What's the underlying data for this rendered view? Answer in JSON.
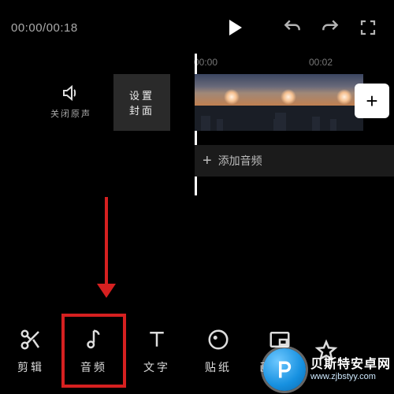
{
  "topbar": {
    "current_time": "00:00",
    "total_time": "00:18",
    "time_display": "00:00/00:18"
  },
  "ruler": {
    "t0": "00:00",
    "t1": "00:02"
  },
  "mute": {
    "label": "关闭原声"
  },
  "cover": {
    "line1": "设置",
    "line2": "封面"
  },
  "add_clip_glyph": "+",
  "audio_track": {
    "plus_glyph": "+",
    "label": "添加音频"
  },
  "toolbar": {
    "items": [
      {
        "id": "cut",
        "label": "剪辑"
      },
      {
        "id": "audio",
        "label": "音频"
      },
      {
        "id": "text",
        "label": "文字"
      },
      {
        "id": "sticker",
        "label": "贴纸"
      },
      {
        "id": "pip",
        "label": "画中画"
      },
      {
        "id": "fx",
        "label": "特效"
      }
    ]
  },
  "watermark": {
    "title": "贝斯特安卓网",
    "url": "www.zjbstyy.com"
  }
}
